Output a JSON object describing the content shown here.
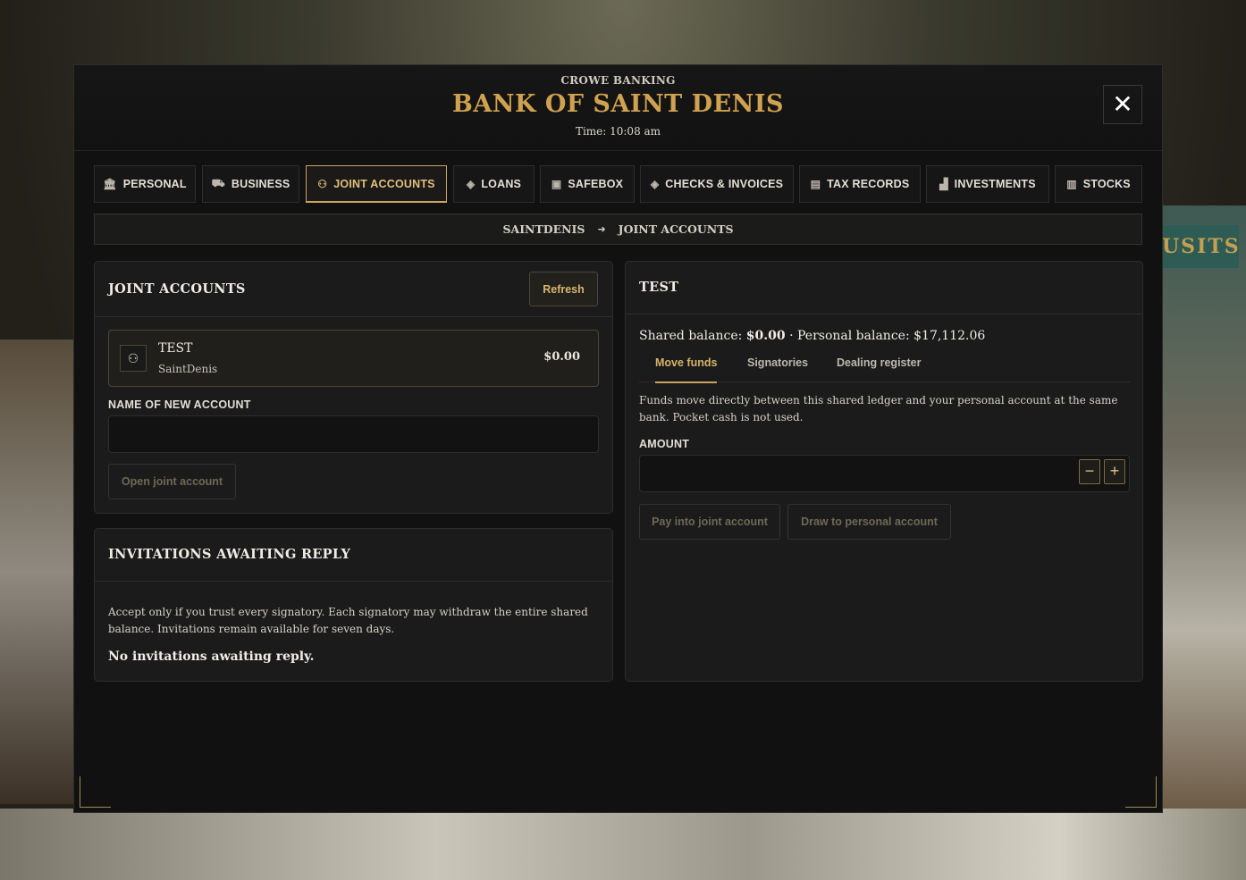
{
  "header": {
    "subtitle": "CROWE BANKING",
    "title": "BANK OF SAINT DENIS",
    "time": "Time: 10:08 am",
    "close_label": "✕"
  },
  "background": {
    "sign_text": "USITS"
  },
  "tabs": [
    {
      "label": "PERSONAL",
      "icon": "bank-icon",
      "glyph": "🏛"
    },
    {
      "label": "BUSINESS",
      "icon": "business-icon",
      "glyph": "⛟"
    },
    {
      "label": "JOINT ACCOUNTS",
      "icon": "joint-accounts-icon",
      "glyph": "⚇",
      "active": true
    },
    {
      "label": "LOANS",
      "icon": "loans-icon",
      "glyph": "◈"
    },
    {
      "label": "SAFEBOX",
      "icon": "safebox-icon",
      "glyph": "▣"
    },
    {
      "label": "CHECKS & INVOICES",
      "icon": "checks-icon",
      "glyph": "◈"
    },
    {
      "label": "TAX RECORDS",
      "icon": "tax-records-icon",
      "glyph": "▤"
    },
    {
      "label": "INVESTMENTS",
      "icon": "investments-icon",
      "glyph": "▟"
    },
    {
      "label": "STOCKS",
      "icon": "stocks-icon",
      "glyph": "▥"
    }
  ],
  "breadcrumb": {
    "from": "SAINTDENIS",
    "arrow": "➜",
    "to": "JOINT ACCOUNTS"
  },
  "joint_panel": {
    "title": "JOINT ACCOUNTS",
    "refresh_label": "Refresh",
    "accounts": [
      {
        "name": "TEST",
        "bank": "SaintDenis",
        "amount": "$0.00",
        "glyph": "⚇"
      }
    ],
    "new_account_label": "NAME OF NEW ACCOUNT",
    "new_account_value": "",
    "open_label": "Open joint account"
  },
  "invitations_panel": {
    "title": "INVITATIONS AWAITING REPLY",
    "notice": "Accept only if you trust every signatory. Each signatory may withdraw the entire shared balance. Invitations remain available for seven days.",
    "empty": "No invitations awaiting reply."
  },
  "detail_panel": {
    "title": "TEST",
    "shared_label": "Shared balance:",
    "shared_value": "$0.00",
    "separator": "·",
    "personal_label": "Personal balance:",
    "personal_value": "$17,112.06",
    "subtabs": [
      "Move funds",
      "Signatories",
      "Dealing register"
    ],
    "active_subtab": "Move funds",
    "info": "Funds move directly between this shared ledger and your personal account at the same bank. Pocket cash is not used.",
    "amount_label": "AMOUNT",
    "amount_value": "",
    "minus": "−",
    "plus": "+",
    "pay_in_label": "Pay into joint account",
    "draw_label": "Draw to personal account"
  },
  "colors": {
    "gold": "#d0a24f",
    "panel": "#1b1b1b",
    "modal": "#111112"
  }
}
